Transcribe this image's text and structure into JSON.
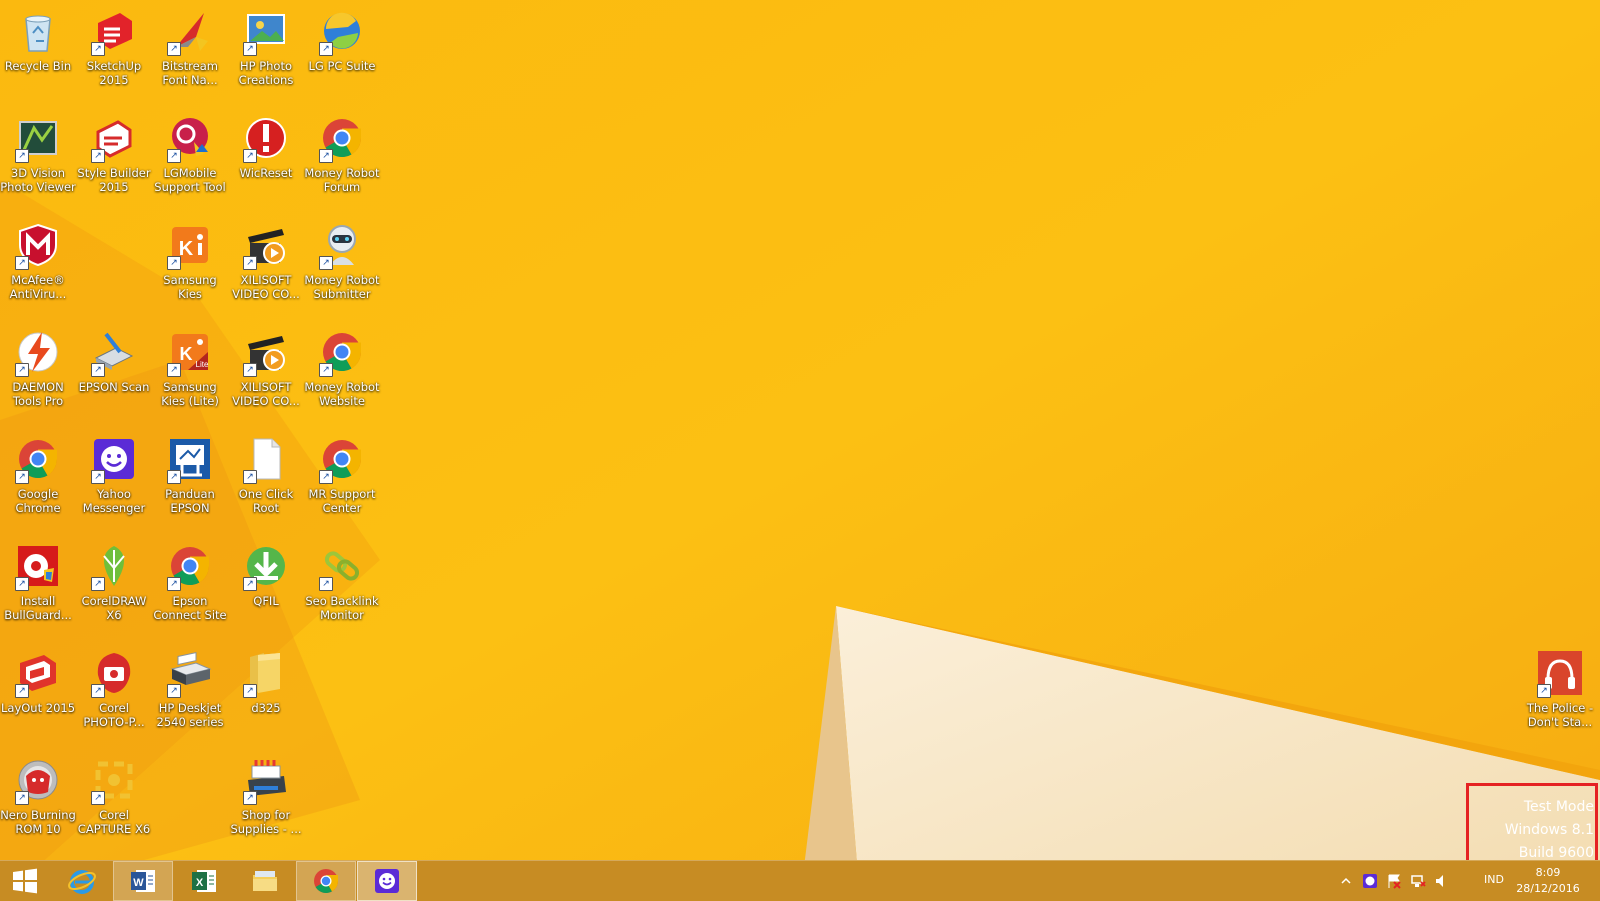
{
  "desktop": {
    "icons": [
      {
        "label": "Recycle Bin",
        "icon": "recycle-bin-icon"
      },
      {
        "label": "SketchUp\n2015",
        "icon": "sketchup-icon"
      },
      {
        "label": "Bitstream\nFont Na...",
        "icon": "bitstream-icon"
      },
      {
        "label": "HP Photo\nCreations",
        "icon": "hp-photo-icon"
      },
      {
        "label": "LG PC Suite",
        "icon": "lg-pc-suite-icon"
      },
      {
        "label": "3D Vision\nPhoto Viewer",
        "icon": "3d-vision-icon"
      },
      {
        "label": "Style Builder\n2015",
        "icon": "style-builder-icon"
      },
      {
        "label": "LGMobile\nSupport Tool",
        "icon": "lgmobile-icon"
      },
      {
        "label": "WicReset",
        "icon": "wicreset-icon"
      },
      {
        "label": "Money Robot\nForum",
        "icon": "chrome-icon"
      },
      {
        "label": "McAfee®\nAntiViru...",
        "icon": "mcafee-icon"
      },
      {
        "label": "Samsung\nKies",
        "icon": "samsung-kies-icon"
      },
      {
        "label": "XILISOFT\nVIDEO CO...",
        "icon": "xilisoft-icon"
      },
      {
        "label": "Money Robot\nSubmitter",
        "icon": "robot-icon"
      },
      {
        "label": "DAEMON\nTools Pro",
        "icon": "daemon-tools-icon"
      },
      {
        "label": "EPSON Scan",
        "icon": "epson-scan-icon"
      },
      {
        "label": "Samsung\nKies (Lite)",
        "icon": "samsung-kies-lite-icon"
      },
      {
        "label": "XILISOFT\nVIDEO CO...",
        "icon": "xilisoft-icon"
      },
      {
        "label": "Money Robot\nWebsite",
        "icon": "chrome-icon"
      },
      {
        "label": "Google\nChrome",
        "icon": "chrome-icon"
      },
      {
        "label": "Yahoo\nMessenger",
        "icon": "yahoo-messenger-icon"
      },
      {
        "label": "Panduan\nEPSON",
        "icon": "panduan-epson-icon"
      },
      {
        "label": "One Click\nRoot",
        "icon": "document-icon"
      },
      {
        "label": "MR Support\nCenter",
        "icon": "chrome-icon"
      },
      {
        "label": "Install\nBullGuard...",
        "icon": "bullguard-icon"
      },
      {
        "label": "CorelDRAW\nX6",
        "icon": "coreldraw-icon"
      },
      {
        "label": "Epson\nConnect Site",
        "icon": "chrome-icon"
      },
      {
        "label": "QFIL",
        "icon": "qfil-icon"
      },
      {
        "label": "Seo Backlink\nMonitor",
        "icon": "seo-backlink-icon"
      },
      {
        "label": "LayOut 2015",
        "icon": "layout-icon"
      },
      {
        "label": "Corel\nPHOTO-P...",
        "icon": "corel-photo-icon"
      },
      {
        "label": "HP Deskjet\n2540 series",
        "icon": "printer-icon"
      },
      {
        "label": "d325",
        "icon": "folder-icon"
      },
      {
        "label": "Nero Burning\nROM 10",
        "icon": "nero-icon"
      },
      {
        "label": "Corel\nCAPTURE X6",
        "icon": "corel-capture-icon"
      },
      {
        "label": "Shop for\nSupplies - ...",
        "icon": "shop-supplies-icon"
      },
      {
        "label": "The Police -\nDon't Sta...",
        "icon": "music-icon"
      }
    ]
  },
  "watermark": {
    "line1": "Test Mode",
    "line2": "Windows 8.1",
    "line3": "Build 9600"
  },
  "taskbar": {
    "pinned": [
      {
        "name": "start",
        "icon": "windows-logo-icon"
      },
      {
        "name": "internet-explorer",
        "icon": "internet-explorer-icon"
      },
      {
        "name": "word",
        "icon": "word-icon"
      },
      {
        "name": "excel",
        "icon": "excel-icon"
      },
      {
        "name": "file-explorer",
        "icon": "file-explorer-icon"
      },
      {
        "name": "chrome",
        "icon": "chrome-icon"
      },
      {
        "name": "yahoo-messenger",
        "icon": "yahoo-messenger-icon"
      }
    ],
    "tray": {
      "language": "IND",
      "time": "8:09",
      "date": "28/12/2016"
    }
  },
  "colors": {
    "wallpaper_base": "#f8b40c",
    "taskbar": "#c78c23",
    "highlight": "#e52222"
  }
}
